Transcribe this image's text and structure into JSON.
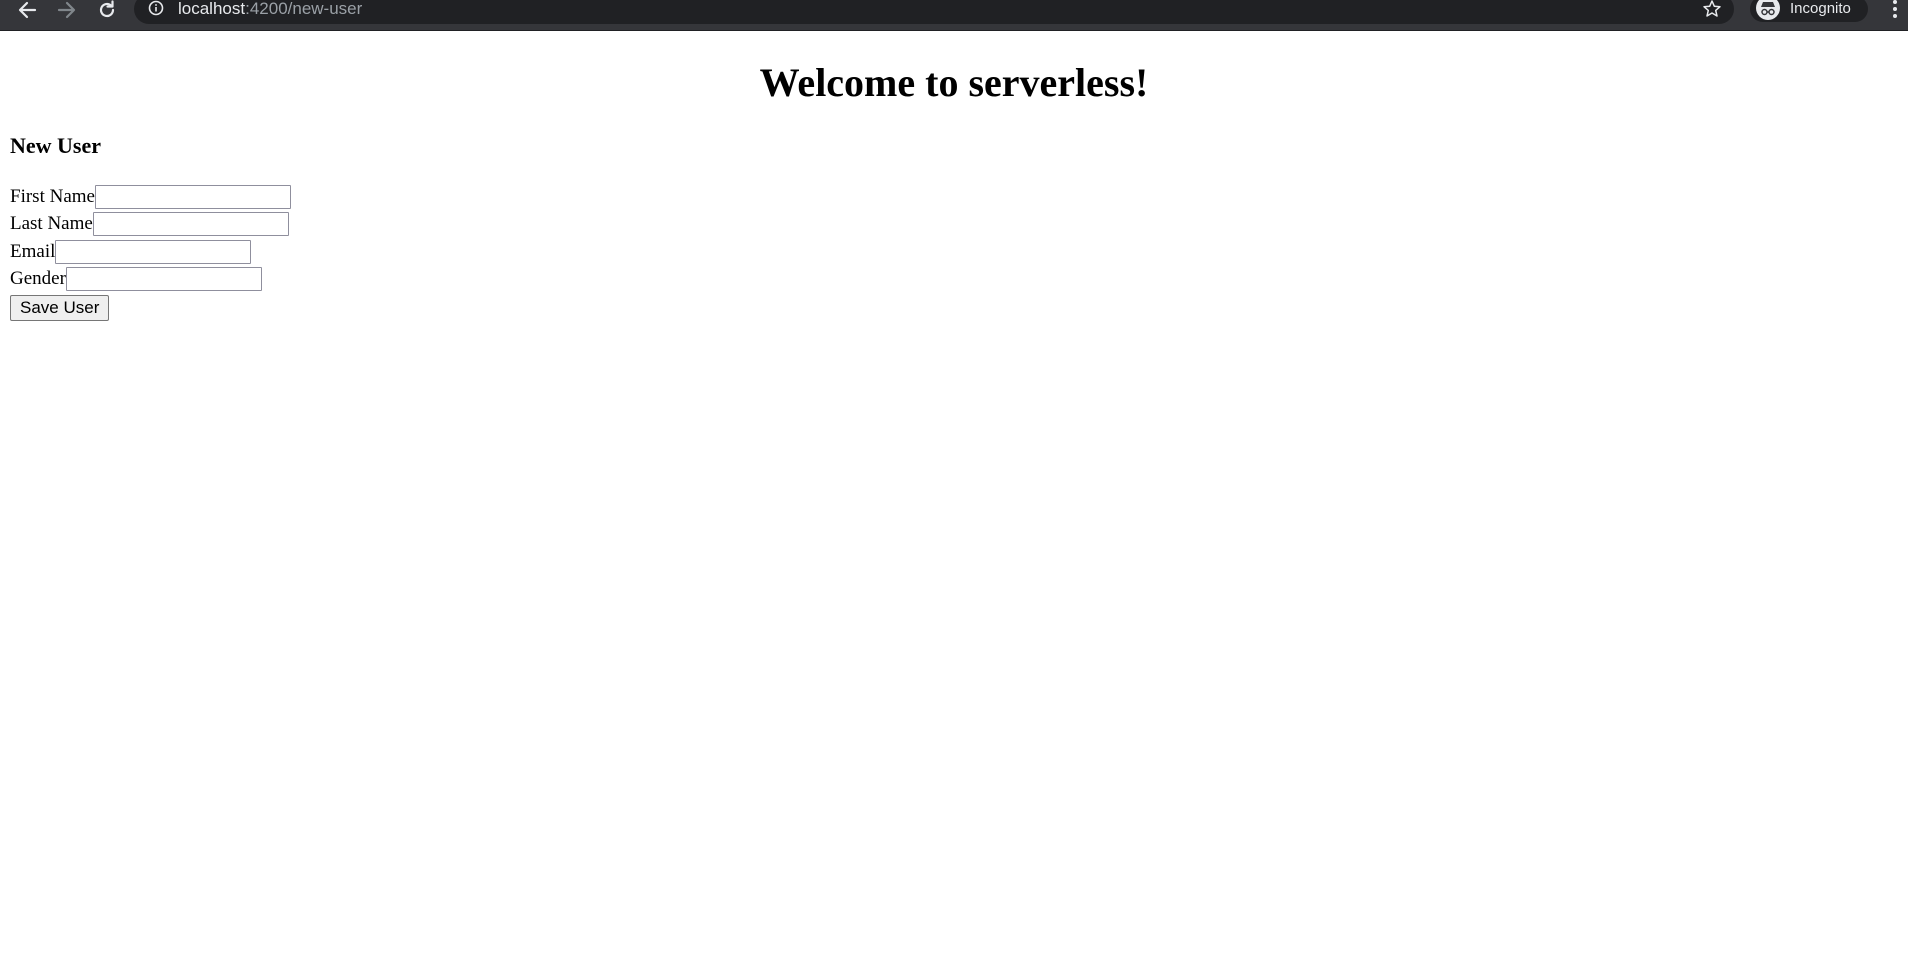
{
  "browser": {
    "url_host": "localhost",
    "url_rest": ":4200/new-user",
    "profile_label": "Incognito",
    "colors": {
      "toolbar": "#35363a",
      "omnibox": "#202124",
      "text_light": "#e8eaed",
      "text_dim": "#9aa0a6"
    },
    "icons": [
      "back-arrow-icon",
      "forward-arrow-icon",
      "reload-icon",
      "info-icon",
      "star-icon",
      "incognito-icon",
      "more-vert-icon"
    ]
  },
  "page": {
    "title": "Welcome to serverless!",
    "section_heading": "New User",
    "form": {
      "fields": [
        {
          "label": "First Name",
          "value": ""
        },
        {
          "label": "Last Name",
          "value": ""
        },
        {
          "label": "Email",
          "value": ""
        },
        {
          "label": "Gender",
          "value": ""
        }
      ],
      "submit_label": "Save User"
    }
  }
}
